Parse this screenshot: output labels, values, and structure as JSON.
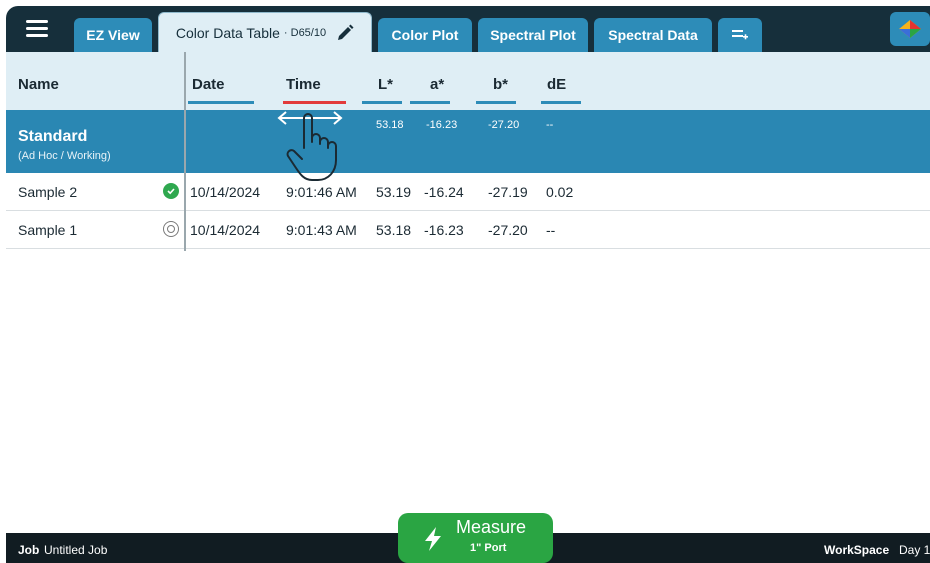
{
  "header": {
    "tabs": [
      {
        "label": "EZ View"
      },
      {
        "label": "Color Data Table",
        "sub": "· D65/10"
      },
      {
        "label": "Color Plot"
      },
      {
        "label": "Spectral Plot"
      },
      {
        "label": "Spectral Data"
      }
    ],
    "add_tab_icon": "="
  },
  "table": {
    "columns": {
      "name": "Name",
      "date": "Date",
      "time": "Time",
      "l": "L*",
      "a": "a*",
      "b": "b*",
      "de": "dE"
    },
    "standard": {
      "name": "Standard",
      "subtitle": "(Ad Hoc / Working)",
      "l": "53.18",
      "a": "-16.23",
      "b": "-27.20",
      "de": "--"
    },
    "rows": [
      {
        "name": "Sample 2",
        "date": "10/14/2024",
        "time": "9:01:46 AM",
        "l": "53.19",
        "a": "-16.24",
        "b": "-27.19",
        "de": "0.02",
        "status": "pass"
      },
      {
        "name": "Sample 1",
        "date": "10/14/2024",
        "time": "9:01:43 AM",
        "l": "53.18",
        "a": "-16.23",
        "b": "-27.20",
        "de": "--",
        "status": "neutral"
      }
    ]
  },
  "footer": {
    "job_label": "Job",
    "job_name": "Untitled Job",
    "workspace_label": "WorkSpace",
    "workspace_name": "Day 1"
  },
  "measure": {
    "label": "Measure",
    "sub": "1\" Port"
  },
  "colors": {
    "topbar": "#162f3b",
    "tab_blue": "#2d8cb8",
    "header_bg": "#dfeef5",
    "standard_row": "#2a87b3",
    "measure_green": "#2aa543",
    "active_column_underline": "#e23b3b"
  }
}
